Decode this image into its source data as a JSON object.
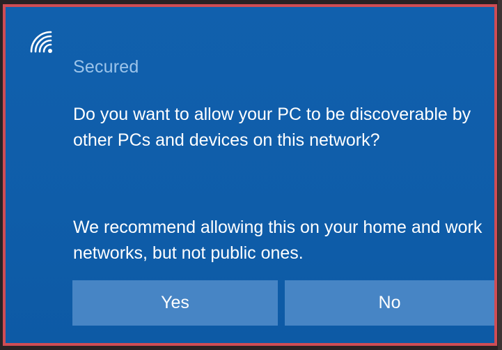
{
  "notification": {
    "status": "Secured",
    "question": "Do you want to allow your PC to be discoverable by other PCs and devices on this network?",
    "recommendation": "We recommend allowing this on your home and work networks, but not public ones.",
    "icon": "wifi-icon"
  },
  "buttons": {
    "yes_label": "Yes",
    "no_label": "No"
  },
  "colors": {
    "panel_background": "#0e5fae",
    "button_background": "#4785c5",
    "status_text": "#9cc4ea",
    "highlight_border": "#cf4d55"
  }
}
